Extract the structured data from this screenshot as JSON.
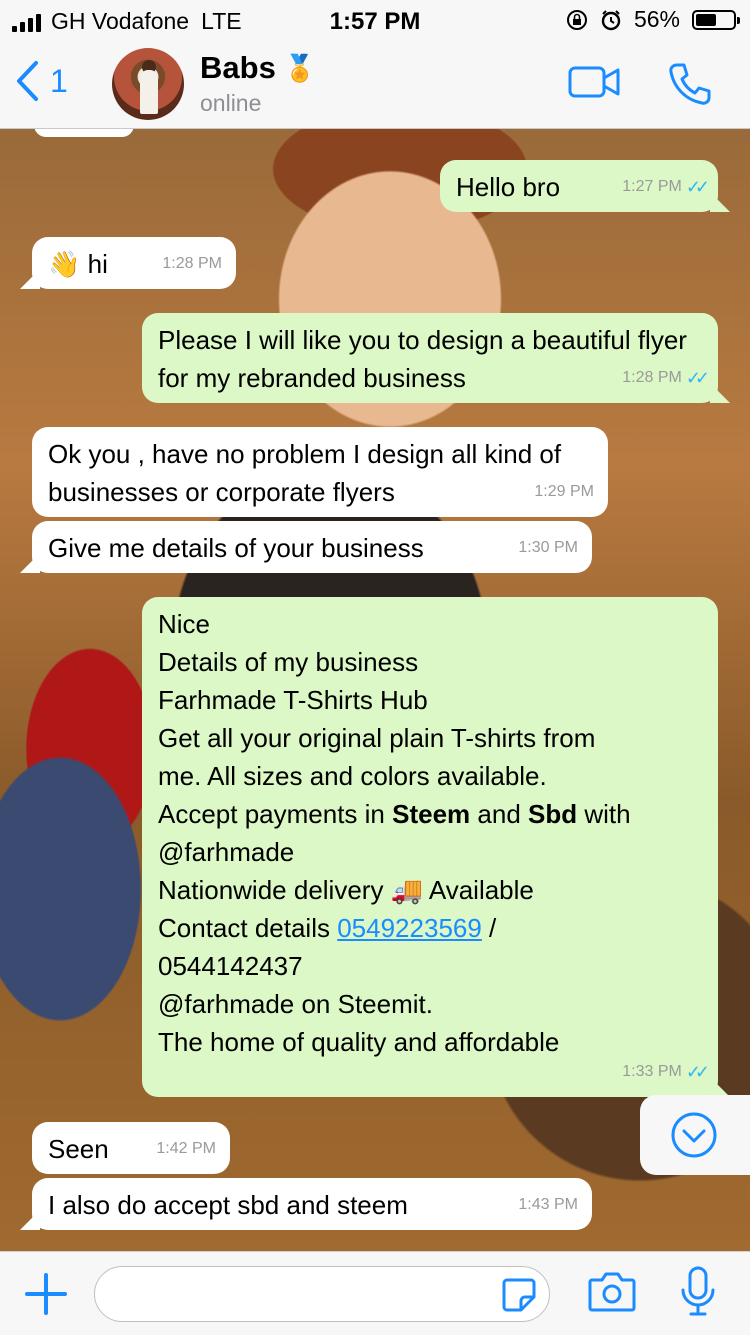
{
  "status_bar": {
    "carrier": "GH Vodafone",
    "network": "LTE",
    "time": "1:57 PM",
    "battery": "56%"
  },
  "header": {
    "back_count": "1",
    "contact_name": "Babs",
    "name_emoji": "🏅",
    "contact_status": "online"
  },
  "messages": [
    {
      "dir": "out",
      "text": "Hello bro",
      "time": "1:27 PM"
    },
    {
      "dir": "in",
      "text": "hi",
      "emoji": "👋",
      "time": "1:28 PM"
    },
    {
      "dir": "out",
      "text": "Please I will like you to design a beautiful flyer for my rebranded business",
      "time": "1:28 PM"
    },
    {
      "dir": "in",
      "text": "Ok you , have no problem I design all kind of businesses or corporate flyers",
      "time": "1:29 PM"
    },
    {
      "dir": "in",
      "text": "Give me details of your business",
      "time": "1:30 PM"
    },
    {
      "dir": "out",
      "time": "1:33 PM",
      "lines": {
        "l1": "Nice",
        "l2": "Details of my business",
        "l3": "Farhmade T-Shirts Hub",
        "l4": "Get all your original plain T-shirts from",
        "l5": "me. All sizes and colors available.",
        "l6a": "Accept payments in ",
        "l6b": "Steem",
        "l6c": " and ",
        "l6d": "Sbd",
        "l6e": " with",
        "l7": "@farhmade",
        "l8a": "Nationwide delivery ",
        "l8emoji": "🚚",
        "l8b": " Available",
        "l9a": "Contact details ",
        "l9link": "0549223569",
        "l9b": " /",
        "l10": "0544142437",
        "l11": "@farhmade on Steemit.",
        "l12": "The home of quality and affordable"
      }
    },
    {
      "dir": "in",
      "text": "Seen",
      "time": "1:42 PM"
    },
    {
      "dir": "in",
      "text": "I also do accept sbd and steem",
      "time": "1:43 PM"
    }
  ],
  "icons": {
    "back": "chevron-left-icon",
    "video": "video-call-icon",
    "call": "phone-icon",
    "scroll": "scroll-down-icon",
    "add": "plus-icon",
    "sticker": "sticker-icon",
    "camera": "camera-icon",
    "mic": "microphone-icon"
  },
  "colors": {
    "accent": "#1a8cff",
    "outgoing_bubble": "#dcf8c6",
    "incoming_bubble": "#ffffff",
    "read_ticks": "#34b7f1"
  }
}
